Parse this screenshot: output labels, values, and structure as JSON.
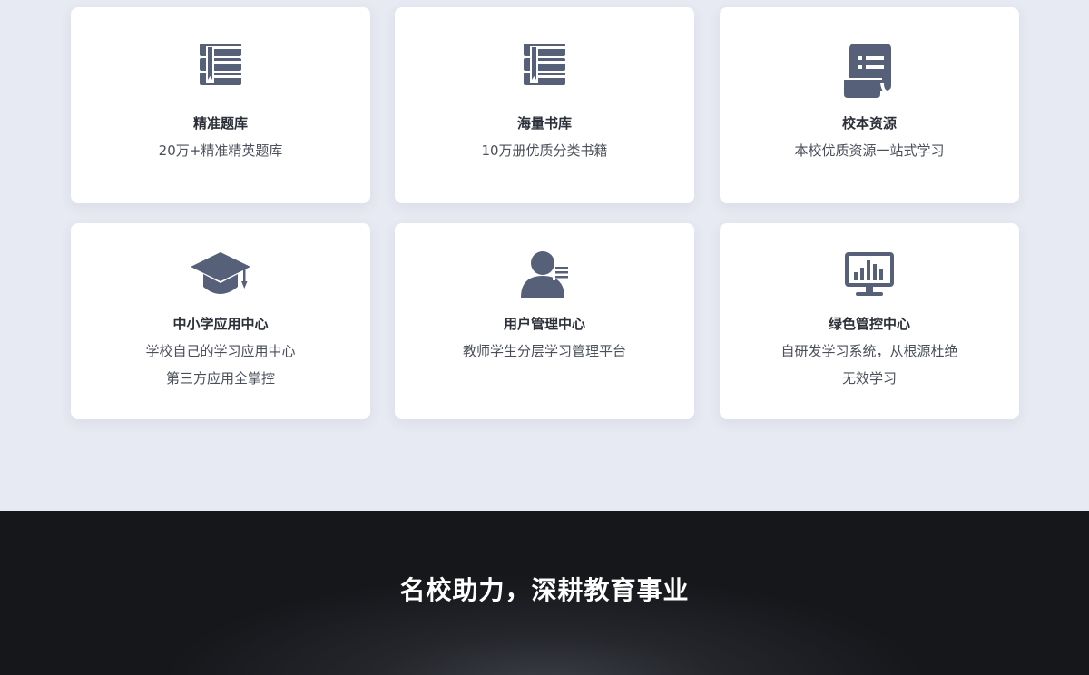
{
  "colors": {
    "background": "#e7eaf2",
    "card": "#ffffff",
    "icon": "#566079",
    "banner": "#15171b"
  },
  "features": [
    {
      "icon": "book-stack-icon",
      "title": "精准题库",
      "desc": [
        "20万+精准精英题库"
      ]
    },
    {
      "icon": "book-stack-icon",
      "title": "海量书库",
      "desc": [
        "10万册优质分类书籍"
      ]
    },
    {
      "icon": "scroll-list-icon",
      "title": "校本资源",
      "desc": [
        "本校优质资源一站式学习"
      ]
    },
    {
      "icon": "graduation-cap-icon",
      "title": "中小学应用中心",
      "desc": [
        "学校自己的学习应用中心",
        "第三方应用全掌控"
      ]
    },
    {
      "icon": "user-list-icon",
      "title": "用户管理中心",
      "desc": [
        "教师学生分层学习管理平台"
      ]
    },
    {
      "icon": "monitor-chart-icon",
      "title": "绿色管控中心",
      "desc": [
        "自研发学习系统，从根源杜绝",
        "无效学习"
      ]
    }
  ],
  "banner": {
    "title": "名校助力，深耕教育事业"
  }
}
